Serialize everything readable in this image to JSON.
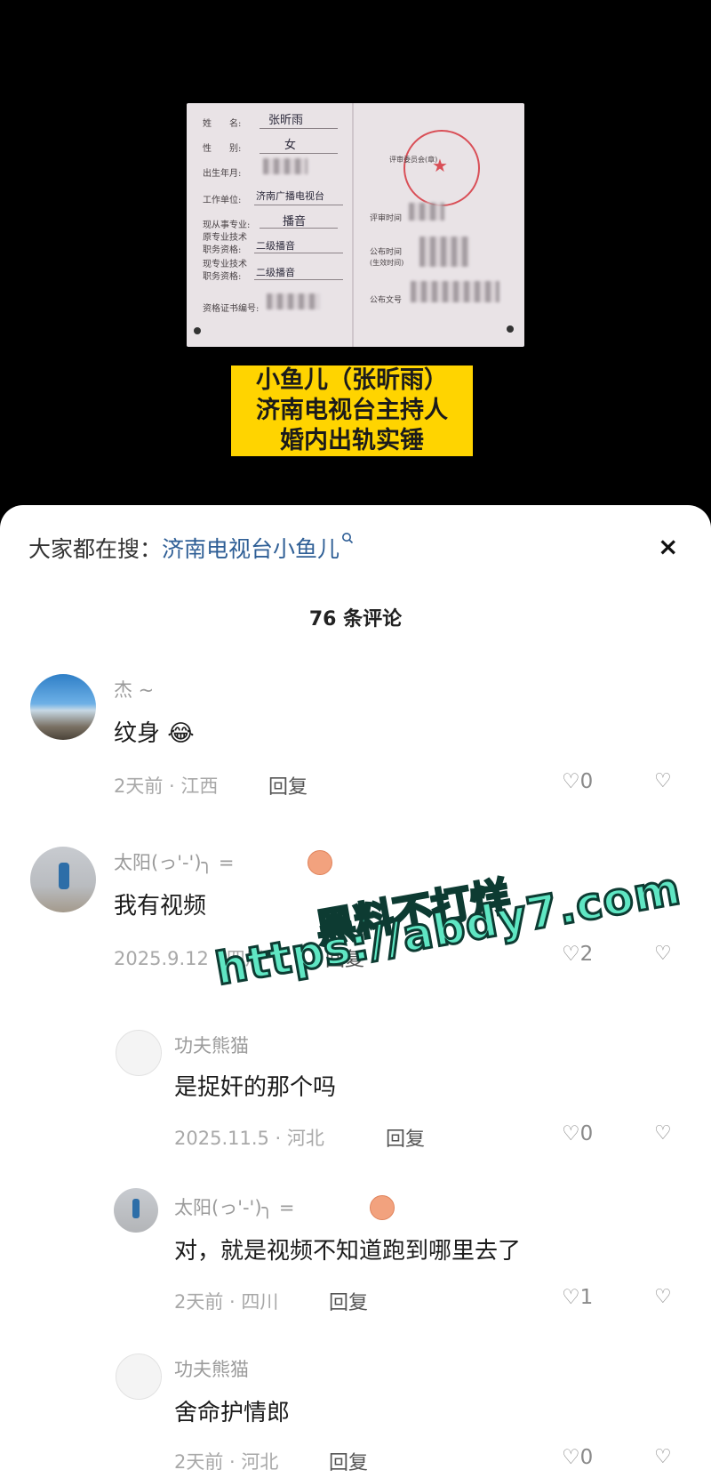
{
  "certificate": {
    "fields": [
      "姓　　名:",
      "性　　别:",
      "出生年月:",
      "工作单位:",
      "现从事专业:",
      "原专业技术",
      "职务资格:",
      "现专业技术",
      "职务资格:",
      "资格证书编号:"
    ],
    "values": [
      "张昕雨",
      "女",
      "济南广播电视台",
      "播音",
      "二级播音",
      "二级播音"
    ],
    "right_fields": [
      "评审委员会(章)",
      "评审时间",
      "公布时间",
      "(生效时间)",
      "公布文号"
    ]
  },
  "caption": {
    "line1": "小鱼儿（张昕雨）",
    "line2": "济南电视台主持人",
    "line3": "婚内出轨实锤"
  },
  "sheet": {
    "search_prefix": "大家都在搜：",
    "search_keyword": "济南电视台小鱼儿",
    "search_icon": "search-icon",
    "close_symbol": "×",
    "comment_count": "76 条评论"
  },
  "comments": [
    {
      "name": "杰 ~",
      "text": "纹身",
      "emoji": "😂",
      "date": "2天前 · 江西",
      "reply": "回复",
      "likes": "0"
    },
    {
      "name": "太阳(っ'-')╮ =",
      "text": "我有视频",
      "date": "2025.9.12 · 四川",
      "reply": "回复",
      "likes": "2"
    },
    {
      "name": "功夫熊猫",
      "text": "是捉奸的那个吗",
      "date": "2025.11.5 · 河北",
      "reply": "回复",
      "likes": "0"
    },
    {
      "name": "太阳(っ'-')╮ =",
      "text": "对，就是视频不知道跑到哪里去了",
      "date": "2天前 · 四川",
      "reply": "回复",
      "likes": "1"
    },
    {
      "name": "功夫熊猫",
      "text": "舍命护情郎",
      "date": "2天前 · 河北",
      "reply": "回复",
      "likes": "0"
    }
  ],
  "icons": {
    "like": "♡",
    "dislike": "♡"
  },
  "watermark": {
    "line1": "黑料不打烊",
    "line2": "https://abdy7.com"
  }
}
